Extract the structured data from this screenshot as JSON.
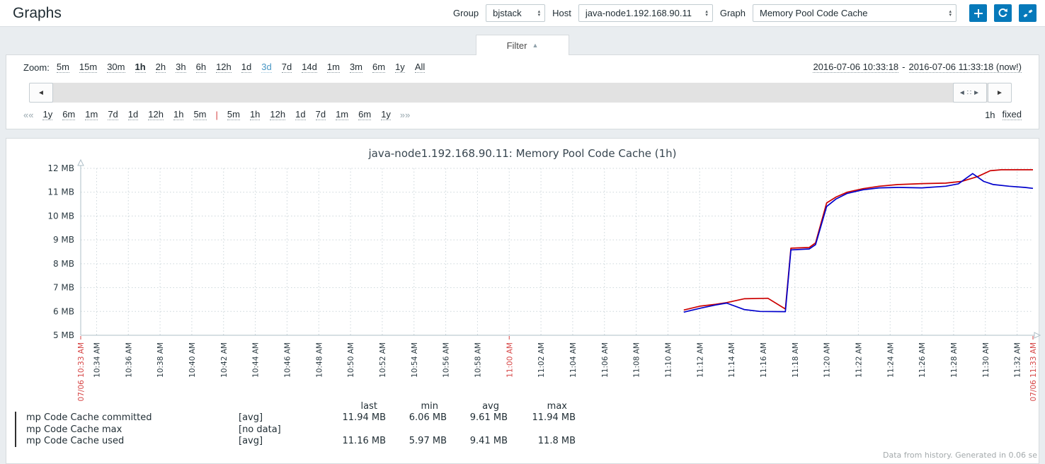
{
  "colors": {
    "accent": "#0679BA",
    "alert_red": "#D64545"
  },
  "header": {
    "title": "Graphs",
    "group_label": "Group",
    "group_value": "bjstack",
    "host_label": "Host",
    "host_value": "java-node1.192.168.90.11",
    "graph_label": "Graph",
    "graph_value": "Memory Pool Code Cache"
  },
  "filter": {
    "tab_label": "Filter",
    "tab_arrow": "▲",
    "zoom_label": "Zoom:",
    "zoom_links": [
      {
        "label": "5m",
        "state": "normal"
      },
      {
        "label": "15m",
        "state": "normal"
      },
      {
        "label": "30m",
        "state": "normal"
      },
      {
        "label": "1h",
        "state": "selected"
      },
      {
        "label": "2h",
        "state": "normal"
      },
      {
        "label": "3h",
        "state": "normal"
      },
      {
        "label": "6h",
        "state": "normal"
      },
      {
        "label": "12h",
        "state": "normal"
      },
      {
        "label": "1d",
        "state": "normal"
      },
      {
        "label": "3d",
        "state": "accent"
      },
      {
        "label": "7d",
        "state": "normal"
      },
      {
        "label": "14d",
        "state": "normal"
      },
      {
        "label": "1m",
        "state": "normal"
      },
      {
        "label": "3m",
        "state": "normal"
      },
      {
        "label": "6m",
        "state": "normal"
      },
      {
        "label": "1y",
        "state": "normal"
      },
      {
        "label": "All",
        "state": "normal"
      }
    ],
    "date_from": "2016-07-06 10:33:18",
    "date_sep": "-",
    "date_to": "2016-07-06 11:33:18 (now!)",
    "scrollbar": {
      "left_arrow": "◄",
      "handle": "◄∷►",
      "right_arrow": "►"
    },
    "nav": {
      "prev": "««",
      "left_links": [
        "1y",
        "6m",
        "1m",
        "7d",
        "1d",
        "12h",
        "1h",
        "5m"
      ],
      "separator": "|",
      "right_links": [
        "5m",
        "1h",
        "12h",
        "1d",
        "7d",
        "1m",
        "6m",
        "1y"
      ],
      "next": "»»",
      "span_label": "1h",
      "fixed_label": "fixed"
    }
  },
  "chart_data": {
    "type": "line",
    "title": "java-node1.192.168.90.11: Memory Pool Code Cache (1h)",
    "y_unit": "MB",
    "ylim": [
      5,
      12
    ],
    "x_range_minutes": [
      0,
      60
    ],
    "grid": true,
    "legend_position": "bottom-left",
    "y_ticks": [
      {
        "v": 12,
        "label": "12 MB"
      },
      {
        "v": 11,
        "label": "11 MB"
      },
      {
        "v": 10,
        "label": "10 MB"
      },
      {
        "v": 9,
        "label": "9 MB"
      },
      {
        "v": 8,
        "label": "8 MB"
      },
      {
        "v": 7,
        "label": "7 MB"
      },
      {
        "v": 6,
        "label": "6 MB"
      },
      {
        "v": 5,
        "label": "5 MB"
      }
    ],
    "x_ticks": [
      {
        "m": 0,
        "label": "07/06 10:33 AM",
        "red": true
      },
      {
        "m": 1,
        "label": "10:34 AM"
      },
      {
        "m": 3,
        "label": "10:36 AM"
      },
      {
        "m": 5,
        "label": "10:38 AM"
      },
      {
        "m": 7,
        "label": "10:40 AM"
      },
      {
        "m": 9,
        "label": "10:42 AM"
      },
      {
        "m": 11,
        "label": "10:44 AM"
      },
      {
        "m": 13,
        "label": "10:46 AM"
      },
      {
        "m": 15,
        "label": "10:48 AM"
      },
      {
        "m": 17,
        "label": "10:50 AM"
      },
      {
        "m": 19,
        "label": "10:52 AM"
      },
      {
        "m": 21,
        "label": "10:54 AM"
      },
      {
        "m": 23,
        "label": "10:56 AM"
      },
      {
        "m": 25,
        "label": "10:58 AM"
      },
      {
        "m": 27,
        "label": "11:00 AM",
        "red": true
      },
      {
        "m": 29,
        "label": "11:02 AM"
      },
      {
        "m": 31,
        "label": "11:04 AM"
      },
      {
        "m": 33,
        "label": "11:06 AM"
      },
      {
        "m": 35,
        "label": "11:08 AM"
      },
      {
        "m": 37,
        "label": "11:10 AM"
      },
      {
        "m": 39,
        "label": "11:12 AM"
      },
      {
        "m": 41,
        "label": "11:14 AM"
      },
      {
        "m": 43,
        "label": "11:16 AM"
      },
      {
        "m": 45,
        "label": "11:18 AM"
      },
      {
        "m": 47,
        "label": "11:20 AM"
      },
      {
        "m": 49,
        "label": "11:22 AM"
      },
      {
        "m": 51,
        "label": "11:24 AM"
      },
      {
        "m": 53,
        "label": "11:26 AM"
      },
      {
        "m": 55,
        "label": "11:28 AM"
      },
      {
        "m": 57,
        "label": "11:30 AM"
      },
      {
        "m": 59,
        "label": "11:32 AM"
      },
      {
        "m": 60,
        "label": "07/06 11:33 AM",
        "red": true
      }
    ],
    "series": [
      {
        "name": "mp Code Cache committed",
        "color": "#CC0000",
        "func": "[avg]",
        "points": [
          [
            38,
            6.06
          ],
          [
            39,
            6.22
          ],
          [
            40,
            6.3
          ],
          [
            40.7,
            6.37
          ],
          [
            41.8,
            6.53
          ],
          [
            43.3,
            6.55
          ],
          [
            44.4,
            6.1
          ],
          [
            44.75,
            8.65
          ],
          [
            45.9,
            8.68
          ],
          [
            46.3,
            8.87
          ],
          [
            47,
            10.55
          ],
          [
            47.6,
            10.8
          ],
          [
            48.3,
            11.0
          ],
          [
            49.3,
            11.15
          ],
          [
            50.3,
            11.25
          ],
          [
            51.5,
            11.32
          ],
          [
            53,
            11.36
          ],
          [
            54.5,
            11.38
          ],
          [
            55.5,
            11.45
          ],
          [
            56.5,
            11.65
          ],
          [
            57.3,
            11.9
          ],
          [
            58,
            11.94
          ],
          [
            60,
            11.94
          ]
        ]
      },
      {
        "name": "mp Code Cache max",
        "color": "#00CC00",
        "func": "[no data]",
        "points": []
      },
      {
        "name": "mp Code Cache used",
        "color": "#0000CC",
        "func": "[avg]",
        "points": [
          [
            38,
            5.97
          ],
          [
            39,
            6.13
          ],
          [
            40,
            6.27
          ],
          [
            40.7,
            6.35
          ],
          [
            41.8,
            6.08
          ],
          [
            42.8,
            6.0
          ],
          [
            44.4,
            5.99
          ],
          [
            44.75,
            8.58
          ],
          [
            45.9,
            8.62
          ],
          [
            46.3,
            8.8
          ],
          [
            47,
            10.4
          ],
          [
            47.6,
            10.72
          ],
          [
            48.3,
            10.95
          ],
          [
            49.3,
            11.1
          ],
          [
            50.3,
            11.18
          ],
          [
            51.5,
            11.2
          ],
          [
            53,
            11.18
          ],
          [
            54.5,
            11.25
          ],
          [
            55.3,
            11.35
          ],
          [
            56.2,
            11.78
          ],
          [
            56.9,
            11.45
          ],
          [
            57.5,
            11.32
          ],
          [
            58.5,
            11.25
          ],
          [
            59.5,
            11.2
          ],
          [
            60,
            11.16
          ]
        ]
      }
    ],
    "legend": {
      "headers": [
        "last",
        "min",
        "avg",
        "max"
      ],
      "rows": [
        {
          "series": 0,
          "values": [
            "11.94 MB",
            "6.06 MB",
            "9.61 MB",
            "11.94 MB"
          ]
        },
        {
          "series": 1,
          "values": [
            "",
            "",
            "",
            ""
          ]
        },
        {
          "series": 2,
          "values": [
            "11.16 MB",
            "5.97 MB",
            "9.41 MB",
            "11.8 MB"
          ]
        }
      ]
    }
  },
  "footer_note": "Data from history. Generated in 0.06 se"
}
